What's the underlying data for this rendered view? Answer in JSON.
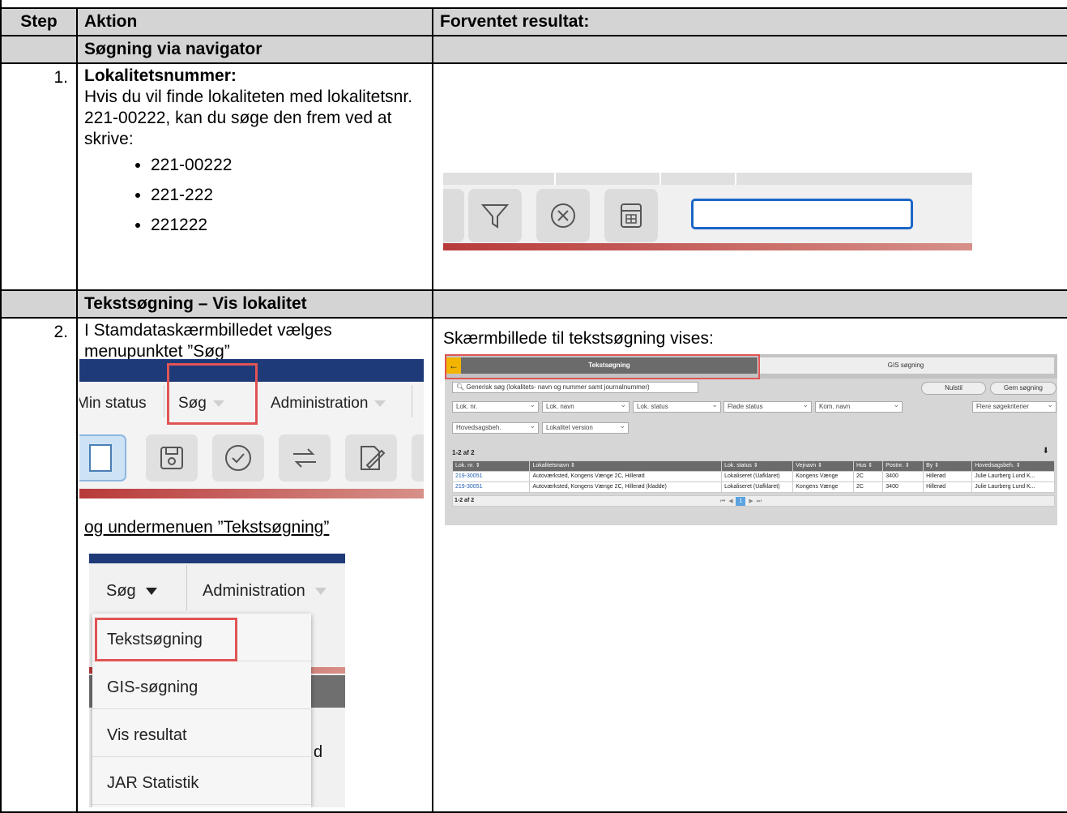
{
  "table": {
    "headers": {
      "step": "Step",
      "action": "Aktion",
      "result": "Forventet resultat:"
    }
  },
  "section1": {
    "title": "Søgning via navigator"
  },
  "step1": {
    "number": "1.",
    "title": "Lokalitetsnummer:",
    "description": "Hvis du vil finde lokaliteten med lokalitetsnr. 221-00222, kan du søge den frem ved at skrive:",
    "bullets": [
      "221-00222",
      "221-222",
      "221222"
    ]
  },
  "section2": {
    "title": "Tekstsøgning – Vis lokalitet"
  },
  "step2": {
    "number": "2.",
    "text1": "I Stamdataskærmbilledet vælges menupunktet ”Søg”",
    "text2": "og undermenuen ”Tekstsøgning”",
    "result_text": "Skærmbillede til tekstsøgning vises:"
  },
  "menubar": {
    "status": "Min status",
    "search": "Søg",
    "admin": "Administration"
  },
  "dropdown": {
    "search": "Søg",
    "admin": "Administration",
    "items": [
      "Tekstsøgning",
      "GIS-søgning",
      "Vis resultat",
      "JAR Statistik"
    ],
    "bg_text": "d"
  },
  "app": {
    "tab_active": "Tekstsøgning",
    "tab_gis": "GIS søgning",
    "search_placeholder": "Generisk søg (lokalitets- navn og nummer samt journalnummer)",
    "reset": "Nulstil",
    "save": "Gem søgning",
    "filters_row1": [
      "Lok. nr.",
      "Lok. navn",
      "Lok. status",
      "Flade status",
      "Kom. navn"
    ],
    "more": "Flere søgekriterier",
    "filters_row2": [
      "Hovedsagsbeh.",
      "Lokalitet version"
    ],
    "count": "1-2 af 2",
    "columns": [
      "Lok. nr. ⇕",
      "Lokalitetsnavn ⇕",
      "Lok. status ⇕",
      "Vejnavn ⇕",
      "Hus ⇕",
      "Postnr. ⇕",
      "By ⇕",
      "Hovedsagsbeh. ⇕"
    ],
    "rows": [
      [
        "219-30051",
        "Autoværksted, Kongens Vænge 2C, Hillerød",
        "Lokaliseret (Uafklaret)",
        "Kongens Vænge",
        "2C",
        "3400",
        "Hillerød",
        "Julie Laurberg Lund K..."
      ],
      [
        "219-30051",
        "Autoværksted, Kongens Vænge 2C, Hillerød (kladde)",
        "Lokaliseret (Uafklaret)",
        "Kongens Vænge",
        "2C",
        "3400",
        "Hillerød",
        "Julie Laurberg Lund K..."
      ]
    ],
    "footer_count": "1-2 af 2",
    "pager": {
      "first": "⏮",
      "prev": "◀",
      "page": "1",
      "next": "▶",
      "last": "⏭"
    }
  },
  "colors": {
    "highlight": "#e05454",
    "accent_blue": "#1a66c9",
    "navy": "#1f3a78"
  }
}
